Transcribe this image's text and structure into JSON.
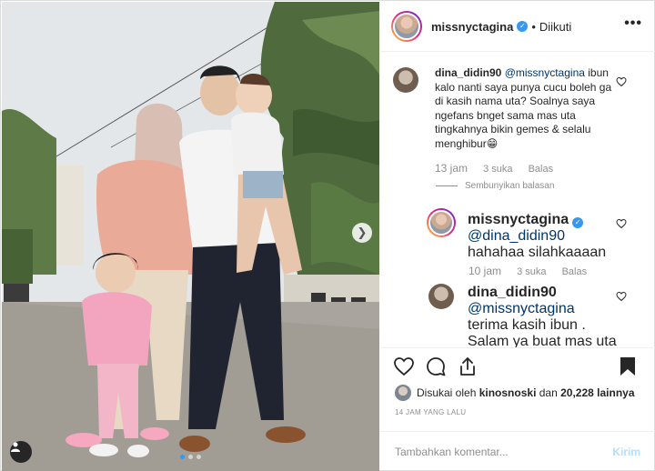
{
  "post": {
    "username": "missnyctagina",
    "verified": true,
    "follow_status": "Diikuti",
    "separator": "•",
    "more_label": "•••"
  },
  "photo": {
    "carousel_dots": 3,
    "active_dot": 1,
    "next_icon": "chevron-right-icon",
    "tag_icon": "user-tag-icon"
  },
  "comments": [
    {
      "username": "dina_didin90",
      "mention": "@missnyctagina",
      "text": "ibun kalo nanti saya punya cucu boleh ga di kasih nama uta? Soalnya saya ngefans bnget sama mas uta tingkahnya bikin gemes & selalu menghibur😁",
      "time": "13 jam",
      "likes": "3 suka",
      "reply": "Balas"
    },
    {
      "username": "missnyctagina",
      "verified": true,
      "mention": "@dina_didin90",
      "text": "hahahaa silahkaaaan",
      "time": "10 jam",
      "likes": "3 suka",
      "reply": "Balas"
    },
    {
      "username": "dina_didin90",
      "mention": "@missnyctagina",
      "text": "terima kasih ibun . Salam ya buat mas uta & ade uti 🙏😍",
      "time": "",
      "likes": "",
      "reply": ""
    }
  ],
  "hide_replies": "Sembunyikan balasan",
  "likes": {
    "prefix": "Disukai oleh",
    "user": "kinosnoski",
    "middle": "dan",
    "count": "20,228 lainnya"
  },
  "time_ago": "14 JAM YANG LALU",
  "add_comment": {
    "placeholder": "Tambahkan komentar...",
    "send_label": "Kirim"
  },
  "colors": {
    "link": "#003569",
    "accent": "#3897f0",
    "muted": "#8e8e8e",
    "send_disabled": "#b2dffc"
  }
}
